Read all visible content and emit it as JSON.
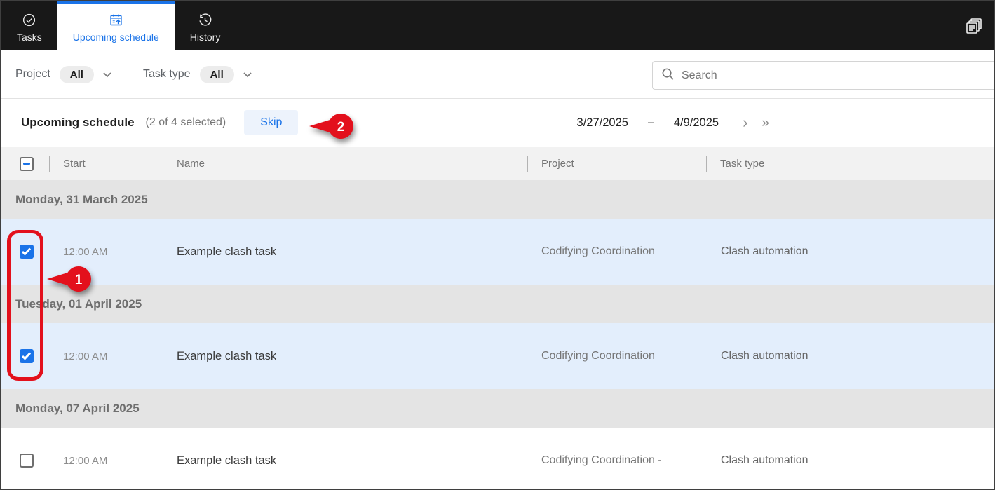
{
  "colors": {
    "accent": "#1a73e8",
    "annotation_red": "#e3101c",
    "selected_row": "#e3eefc",
    "group_row": "#e4e4e4"
  },
  "tabs": {
    "items": [
      {
        "label": "Tasks",
        "icon": "check-circle-icon",
        "active": false
      },
      {
        "label": "Upcoming schedule",
        "icon": "calendar-upload-icon",
        "active": true
      },
      {
        "label": "History",
        "icon": "history-icon",
        "active": false
      }
    ],
    "corner_icon": "stacked-pages-icon"
  },
  "filters": {
    "project_label": "Project",
    "project_value": "All",
    "task_type_label": "Task type",
    "task_type_value": "All",
    "search_placeholder": "Search"
  },
  "action_bar": {
    "title": "Upcoming schedule",
    "selection": "(2 of 4 selected)",
    "skip_label": "Skip",
    "date_from": "3/27/2025",
    "date_separator": "–",
    "date_to": "4/9/2025",
    "next_glyph": "›",
    "last_glyph": "»"
  },
  "table": {
    "columns": [
      "Start",
      "Name",
      "Project",
      "Task type"
    ],
    "select_all_state": "indeterminate",
    "groups": [
      {
        "date": "Monday, 31 March 2025",
        "rows": [
          {
            "checked": true,
            "selected": true,
            "start": "12:00 AM",
            "name": "Example clash task",
            "project": "Codifying Coordination",
            "task_type": "Clash automation"
          }
        ]
      },
      {
        "date": "Tuesday, 01 April 2025",
        "rows": [
          {
            "checked": true,
            "selected": true,
            "start": "12:00 AM",
            "name": "Example clash task",
            "project": "Codifying Coordination",
            "task_type": "Clash automation"
          }
        ]
      },
      {
        "date": "Monday, 07 April 2025",
        "rows": [
          {
            "checked": false,
            "selected": false,
            "start": "12:00 AM",
            "name": "Example clash task",
            "project": "Codifying Coordination -",
            "task_type": "Clash automation"
          }
        ]
      }
    ]
  },
  "annotations": {
    "step1": {
      "label": "1"
    },
    "step2": {
      "label": "2"
    }
  }
}
